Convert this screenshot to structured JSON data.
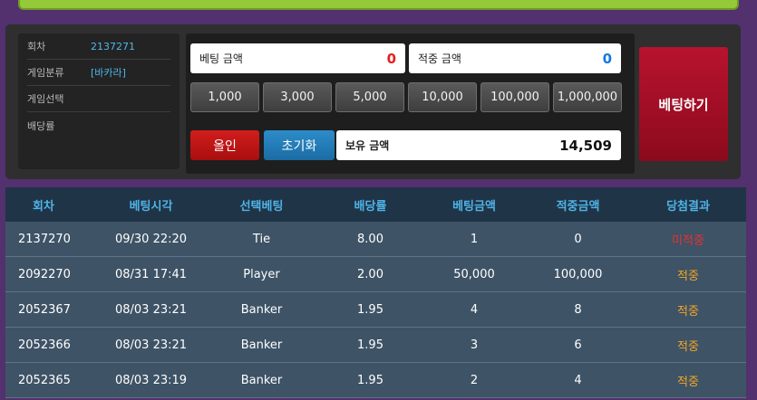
{
  "round_info": {
    "round_label": "회차",
    "round_value": "2137271",
    "game_type_label": "게임분류",
    "game_type_value": "[바카라]",
    "game_select_label": "게임선택",
    "game_select_value": "",
    "odds_label": "배당률",
    "odds_value": ""
  },
  "bet_form": {
    "bet_amount_label": "베팅 금액",
    "bet_amount_value": "0",
    "hit_amount_label": "적중 금액",
    "hit_amount_value": "0",
    "chips": [
      "1,000",
      "3,000",
      "5,000",
      "10,000",
      "100,000",
      "1,000,000"
    ],
    "all_in_label": "올인",
    "reset_label": "초기화",
    "balance_label": "보유 금액",
    "balance_value": "14,509",
    "bet_button_label": "베팅하기"
  },
  "history": {
    "headers": [
      "회차",
      "베팅시각",
      "선택베팅",
      "배당률",
      "베팅금액",
      "적중금액",
      "당첨결과"
    ],
    "rows": [
      [
        "2137270",
        "09/30 22:20",
        "Tie",
        "8.00",
        "1",
        "0",
        "미적중"
      ],
      [
        "2092270",
        "08/31 17:41",
        "Player",
        "2.00",
        "50,000",
        "100,000",
        "적중"
      ],
      [
        "2052367",
        "08/03 23:21",
        "Banker",
        "1.95",
        "4",
        "8",
        "적중"
      ],
      [
        "2052366",
        "08/03 23:21",
        "Banker",
        "1.95",
        "3",
        "6",
        "적중"
      ],
      [
        "2052365",
        "08/03 23:19",
        "Banker",
        "1.95",
        "2",
        "4",
        "적중"
      ]
    ],
    "result_colors": {
      "miss": "#e83030",
      "hit": "#f5a623"
    }
  }
}
